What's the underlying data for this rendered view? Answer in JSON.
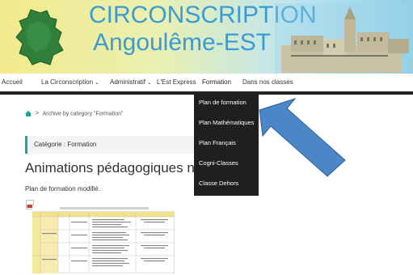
{
  "banner": {
    "title_line1": "CIRCONSCRIPTION",
    "title_line2": "Angoulême-EST"
  },
  "nav": {
    "items": [
      {
        "label": "Accueil",
        "has_submenu": false
      },
      {
        "label": "La Circonscription",
        "has_submenu": true
      },
      {
        "label": "Administratif",
        "has_submenu": true
      },
      {
        "label": "L'Est Express",
        "has_submenu": false
      },
      {
        "label": "Formation",
        "has_submenu": false,
        "active": true
      },
      {
        "label": "Dans nos classes",
        "has_submenu": false
      }
    ],
    "chevron": "⌄"
  },
  "dropdown": {
    "items": [
      {
        "label": "Plan de formation"
      },
      {
        "label": "Plan Mathématiques"
      },
      {
        "label": "Plan Français"
      },
      {
        "label": "Cogni-Classes"
      },
      {
        "label": "Classe Dehors"
      }
    ]
  },
  "breadcrumb": {
    "separator": ">",
    "text": "Archive by category \"Formation\""
  },
  "category": {
    "label": "Catégorie : Formation"
  },
  "post": {
    "title": "Animations pédagogiques novembre-décembre",
    "excerpt": "Plan de formation modifié."
  },
  "colors": {
    "title_blue": "#3c9bd2",
    "nav_bar": "#232323",
    "dropdown_bg": "#1f1f1f",
    "accent_teal": "#1aa3a3",
    "arrow_blue": "#4a86c8",
    "pdf_red": "#d33c2c"
  },
  "icons": [
    "home-icon",
    "pdf-icon",
    "chevron-down-icon"
  ]
}
